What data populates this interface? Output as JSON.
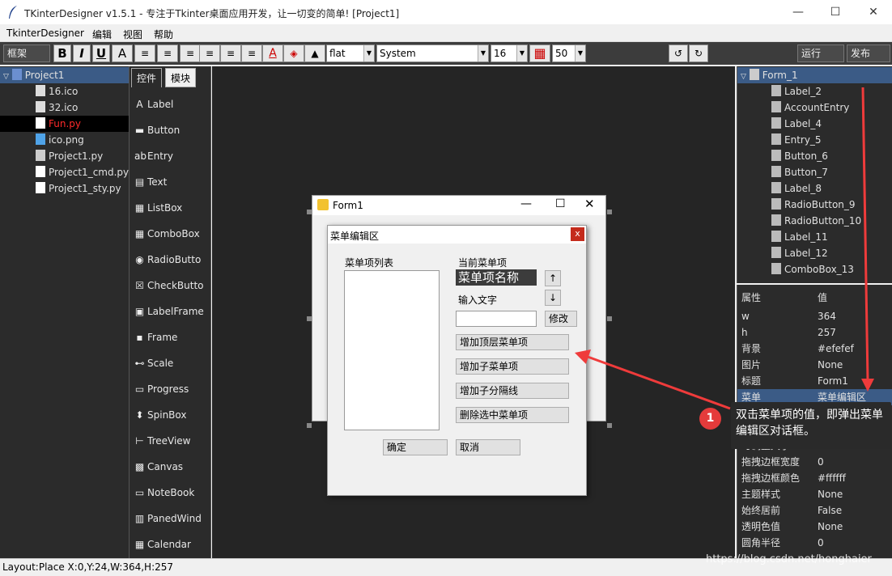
{
  "window": {
    "title": "TKinterDesigner v1.5.1 - 专注于Tkinter桌面应用开发，让一切变的简单!    [Project1]",
    "minimize": "—",
    "maximize": "☐",
    "close": "✕"
  },
  "menubar": [
    "TkinterDesigner",
    "编辑",
    "视图",
    "帮助"
  ],
  "toolbar": {
    "frame_label": "框架",
    "bold": "B",
    "italic": "I",
    "underline": "U",
    "font_a": "A",
    "relief": "flat",
    "font": "System",
    "size": "16",
    "grid": "50",
    "run": "运行",
    "publish": "发布"
  },
  "project_tree": {
    "root": "Project1",
    "items": [
      "16.ico",
      "32.ico",
      "Fun.py",
      "ico.png",
      "Project1.py",
      "Project1_cmd.py",
      "Project1_sty.py"
    ],
    "selected": "Fun.py"
  },
  "palette": {
    "tabs": [
      "控件",
      "模块"
    ],
    "items": [
      "Label",
      "Button",
      "Entry",
      "Text",
      "ListBox",
      "ComboBox",
      "RadioButto",
      "CheckButto",
      "LabelFrame",
      "Frame",
      "Scale",
      "Progress",
      "SpinBox",
      "TreeView",
      "Canvas",
      "NoteBook",
      "PanedWind",
      "Calendar"
    ],
    "icons": [
      "A",
      "▬",
      "ab",
      "▤",
      "▦",
      "▦",
      "◉",
      "☒",
      "▣",
      "▪",
      "⊷",
      "▭",
      "⬍",
      "⊢",
      "▩",
      "▭",
      "▥",
      "▦"
    ]
  },
  "form1": {
    "title": "Form1",
    "dialog": {
      "title": "菜单编辑区",
      "list_label": "菜单项列表",
      "current_label": "当前菜单项",
      "current_value": "菜单项名称",
      "up": "↑",
      "down": "↓",
      "input_label": "输入文字",
      "modify": "修改",
      "add_top": "增加顶层菜单项",
      "add_sub": "增加子菜单项",
      "add_sep": "增加子分隔线",
      "delete": "删除选中菜单项",
      "ok": "确定",
      "cancel": "取消",
      "close": "x"
    }
  },
  "widget_tree": {
    "root": "Form_1",
    "items": [
      "Label_2",
      "AccountEntry",
      "Label_4",
      "Entry_5",
      "Button_6",
      "Button_7",
      "Label_8",
      "RadioButton_9",
      "RadioButton_10",
      "Label_11",
      "Label_12",
      "ComboBox_13"
    ]
  },
  "props": {
    "header_key": "属性",
    "header_val": "值",
    "rows": [
      [
        "w",
        "364"
      ],
      [
        "h",
        "257"
      ],
      [
        "背景",
        "#efefef"
      ],
      [
        "图片",
        "None"
      ],
      [
        "标题",
        "Form1"
      ],
      [
        "菜单",
        "菜单编辑区"
      ],
      [
        "",
        ""
      ],
      [
        "",
        "rue"
      ],
      [
        "可调整大小",
        "True"
      ],
      [
        "拖拽边框宽度",
        "0"
      ],
      [
        "拖拽边框颜色",
        "#ffffff"
      ],
      [
        "主题样式",
        "None"
      ],
      [
        "始终居前",
        "False"
      ],
      [
        "透明色值",
        "None"
      ],
      [
        "圆角半径",
        "0"
      ]
    ]
  },
  "status": "Layout:Place  X:0,Y:24,W:364,H:257",
  "watermark": "https://blog.csdn.net/honghaier",
  "annotation": {
    "badge": "1",
    "text": "双击菜单项的值，即弹出菜单编辑区对话框。"
  }
}
